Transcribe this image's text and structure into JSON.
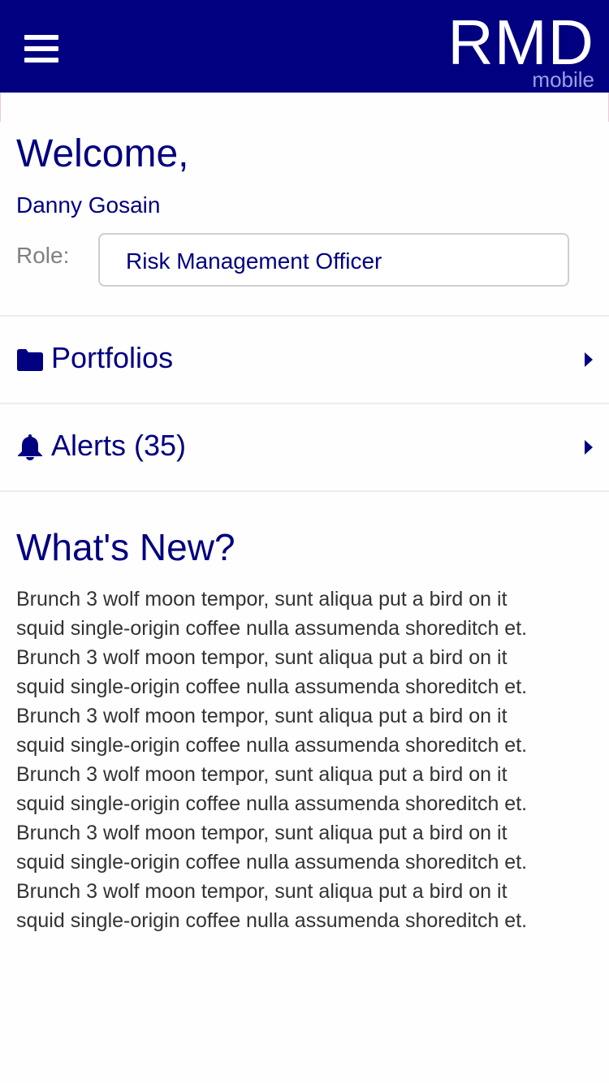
{
  "colors": {
    "header_bg": "#000080",
    "brand_text": "#000080",
    "muted_text": "#808080",
    "body_text": "#333333",
    "divider": "#ededed"
  },
  "header": {
    "menu_icon": "hamburger-menu-icon",
    "logo_main": "RMD",
    "logo_sub": "mobile"
  },
  "welcome": {
    "title": "Welcome,",
    "user_name": "Danny Gosain",
    "role_label": "Role:",
    "role_value": "Risk Management Officer"
  },
  "nav": {
    "portfolios": {
      "icon": "folder-icon",
      "label": "Portfolios",
      "arrow": "chevron-right-icon"
    },
    "alerts": {
      "icon": "bell-icon",
      "label": "Alerts (35)",
      "arrow": "chevron-right-icon"
    }
  },
  "whats_new": {
    "title": "What's New?",
    "lines": [
      "Brunch 3 wolf moon tempor, sunt aliqua put a bird on it",
      "squid single-origin coffee nulla assumenda shoreditch et.",
      "Brunch 3 wolf moon tempor, sunt aliqua put a bird on it",
      "squid single-origin coffee nulla assumenda shoreditch et.",
      "Brunch 3 wolf moon tempor, sunt aliqua put a bird on it",
      "squid single-origin coffee nulla assumenda shoreditch et.",
      "Brunch 3 wolf moon tempor, sunt aliqua put a bird on it",
      "squid single-origin coffee nulla assumenda shoreditch et.",
      "Brunch 3 wolf moon tempor, sunt aliqua put a bird on it",
      "squid single-origin coffee nulla assumenda shoreditch et.",
      "Brunch 3 wolf moon tempor, sunt aliqua put a bird on it",
      "squid single-origin coffee nulla assumenda shoreditch et."
    ]
  }
}
